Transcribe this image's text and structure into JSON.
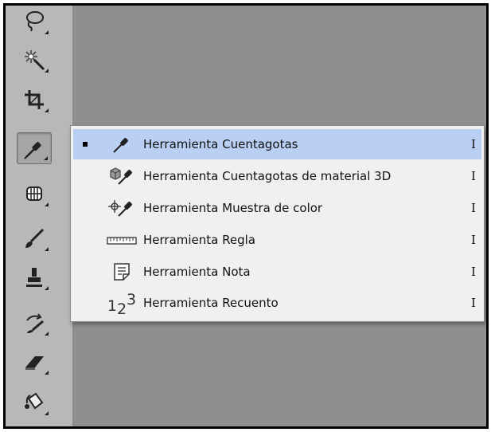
{
  "toolbar": {
    "tools": [
      {
        "name": "lasso-tool",
        "icon": "lasso-icon"
      },
      {
        "name": "magic-wand-tool",
        "icon": "magic-wand-icon"
      },
      {
        "name": "crop-tool",
        "icon": "crop-icon"
      },
      {
        "name": "eyedropper-tool",
        "icon": "eyedropper-icon",
        "active": true
      },
      {
        "name": "spot-healing-tool",
        "icon": "healing-brush-icon"
      },
      {
        "name": "brush-tool",
        "icon": "brush-icon"
      },
      {
        "name": "clone-stamp-tool",
        "icon": "stamp-icon"
      },
      {
        "name": "history-brush-tool",
        "icon": "history-brush-icon"
      },
      {
        "name": "eraser-tool",
        "icon": "eraser-icon"
      },
      {
        "name": "paint-bucket-tool",
        "icon": "paint-bucket-icon"
      }
    ]
  },
  "flyout_menu": {
    "items": [
      {
        "label": "Herramienta Cuentagotas",
        "shortcut": "I",
        "icon": "eyedropper-icon",
        "selected": true
      },
      {
        "label": "Herramienta Cuentagotas de material 3D",
        "shortcut": "I",
        "icon": "3d-material-eyedropper-icon",
        "selected": false
      },
      {
        "label": "Herramienta Muestra de color",
        "shortcut": "I",
        "icon": "color-sampler-icon",
        "selected": false
      },
      {
        "label": "Herramienta Regla",
        "shortcut": "I",
        "icon": "ruler-icon",
        "selected": false
      },
      {
        "label": "Herramienta Nota",
        "shortcut": "I",
        "icon": "note-icon",
        "selected": false
      },
      {
        "label": "Herramienta Recuento",
        "shortcut": "I",
        "icon": "count-icon",
        "icon_text": "123",
        "selected": false
      }
    ]
  },
  "colors": {
    "canvas": "#8f8f8f",
    "toolbar": "#b8b8b8",
    "menu_background": "#f0f0f0",
    "menu_highlight": "#b9cff3"
  }
}
